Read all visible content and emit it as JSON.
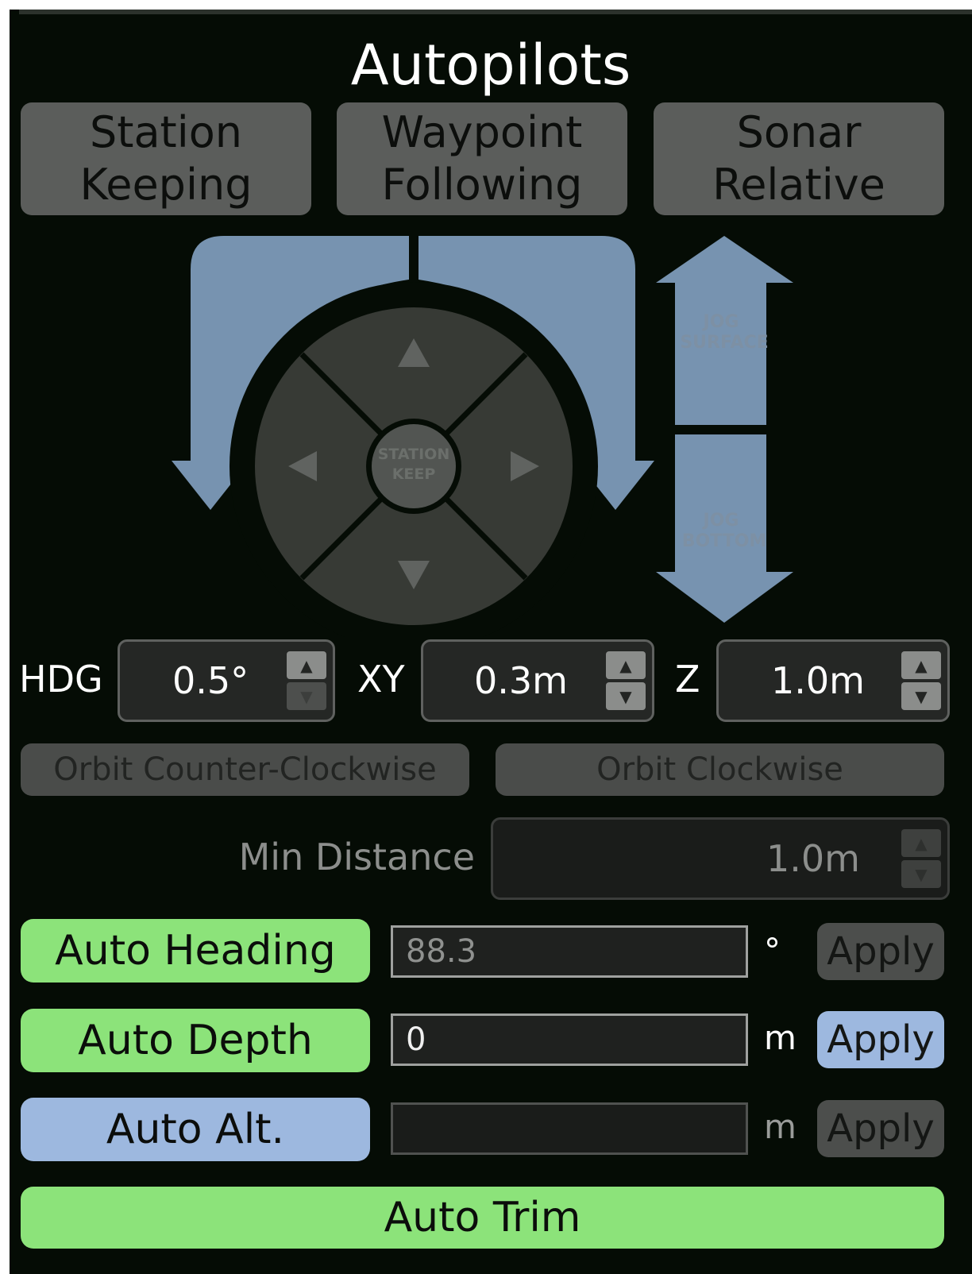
{
  "panel": {
    "title": "Autopilots"
  },
  "modes": [
    {
      "label": "Station\nKeeping"
    },
    {
      "label": "Waypoint\nFollowing"
    },
    {
      "label": "Sonar\nRelative"
    }
  ],
  "joystick": {
    "center_label_line1": "STATION",
    "center_label_line2": "KEEP",
    "jog_surface_line1": "JOG",
    "jog_surface_line2": "SURFACE",
    "jog_bottom_line1": "JOG",
    "jog_bottom_line2": "BOTTOM",
    "arrow_color": "#7793b0",
    "pad_color": "#373a35"
  },
  "steps": {
    "hdg_label": "HDG",
    "hdg_value": "0.5°",
    "xy_label": "XY",
    "xy_value": "0.3m",
    "z_label": "Z",
    "z_value": "1.0m",
    "up_glyph": "▲",
    "down_glyph": "▼"
  },
  "orbit": {
    "ccw_label": "Orbit Counter-Clockwise",
    "cw_label": "Orbit Clockwise"
  },
  "min_distance": {
    "label": "Min Distance",
    "value": "1.0m"
  },
  "auto": {
    "heading": {
      "label": "Auto Heading",
      "value": "88.3",
      "unit": "°",
      "apply": "Apply",
      "active": true
    },
    "depth": {
      "label": "Auto Depth",
      "value": "0",
      "unit": "m",
      "apply": "Apply",
      "active": true
    },
    "altitude": {
      "label": "Auto Alt.",
      "value": "",
      "unit": "m",
      "apply": "Apply",
      "active": false
    },
    "trim": {
      "label": "Auto Trim",
      "active": true
    }
  },
  "colors": {
    "active_green": "#8ce37a",
    "inactive_blue": "#9db8df",
    "background": "#050c05"
  }
}
